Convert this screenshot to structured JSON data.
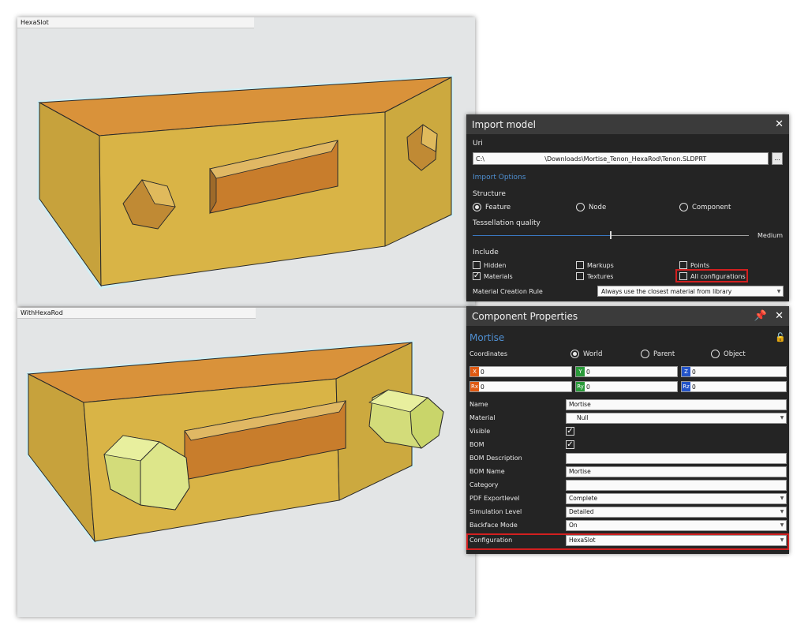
{
  "viewports": {
    "top": {
      "title": "HexaSlot"
    },
    "bottom": {
      "title": "WithHexaRod"
    }
  },
  "import_model": {
    "title": "Import model",
    "uri_label": "Uri",
    "uri_value": "C:\\                              \\Downloads\\Mortise_Tenon_HexaRod\\Tenon.SLDPRT",
    "browse_label": "...",
    "options_heading": "Import Options",
    "structure_label": "Structure",
    "structure_options": [
      {
        "label": "Feature",
        "selected": true
      },
      {
        "label": "Node",
        "selected": false
      },
      {
        "label": "Component",
        "selected": false
      }
    ],
    "tessellation_label": "Tessellation quality",
    "tessellation_value": "Medium",
    "tessellation_level": 0.5,
    "include_label": "Include",
    "include_options": [
      {
        "label": "Hidden",
        "checked": false
      },
      {
        "label": "Markups",
        "checked": false
      },
      {
        "label": "Points",
        "checked": false
      },
      {
        "label": "Materials",
        "checked": true
      },
      {
        "label": "Textures",
        "checked": false
      },
      {
        "label": "All configurations",
        "checked": false
      }
    ],
    "material_rule_label": "Material Creation Rule",
    "material_rule_value": "Always use the closest material from library"
  },
  "component_properties": {
    "title": "Component Properties",
    "component_name": "Mortise",
    "coordinates_label": "Coordinates",
    "coordinate_modes": [
      {
        "label": "World",
        "selected": true
      },
      {
        "label": "Parent",
        "selected": false
      },
      {
        "label": "Object",
        "selected": false
      }
    ],
    "position": [
      {
        "axis": "X",
        "value": "0",
        "color": "#e05a12"
      },
      {
        "axis": "Y",
        "value": "0",
        "color": "#2a9a3a"
      },
      {
        "axis": "Z",
        "value": "0",
        "color": "#2454c8"
      }
    ],
    "rotation": [
      {
        "axis": "Rx",
        "value": "0",
        "color": "#e05a12"
      },
      {
        "axis": "Ry",
        "value": "0",
        "color": "#2a9a3a"
      },
      {
        "axis": "Rz",
        "value": "0",
        "color": "#2454c8"
      }
    ],
    "properties": [
      {
        "label": "Name",
        "value": "Mortise",
        "kind": "text"
      },
      {
        "label": "Material",
        "value": "Null",
        "kind": "dropdown"
      },
      {
        "label": "Visible",
        "value": "",
        "kind": "check",
        "checked": true
      },
      {
        "label": "BOM",
        "value": "",
        "kind": "check",
        "checked": true
      },
      {
        "label": "BOM Description",
        "value": "",
        "kind": "text"
      },
      {
        "label": "BOM Name",
        "value": "Mortise",
        "kind": "text"
      },
      {
        "label": "Category",
        "value": "",
        "kind": "text"
      },
      {
        "label": "PDF Exportlevel",
        "value": "Complete",
        "kind": "dropdown"
      },
      {
        "label": "Simulation Level",
        "value": "Detailed",
        "kind": "dropdown"
      },
      {
        "label": "Backface Mode",
        "value": "On",
        "kind": "dropdown"
      },
      {
        "label": "Configuration",
        "value": "HexaSlot",
        "kind": "dropdown"
      }
    ]
  },
  "colors": {
    "panel_bg": "#242424",
    "panel_header": "#3b3b3b",
    "accent": "#4f8fd1",
    "highlight": "#d21f1f",
    "model_top": "#d9923a",
    "model_front": "#d9b446",
    "rod": "#dde68a"
  }
}
